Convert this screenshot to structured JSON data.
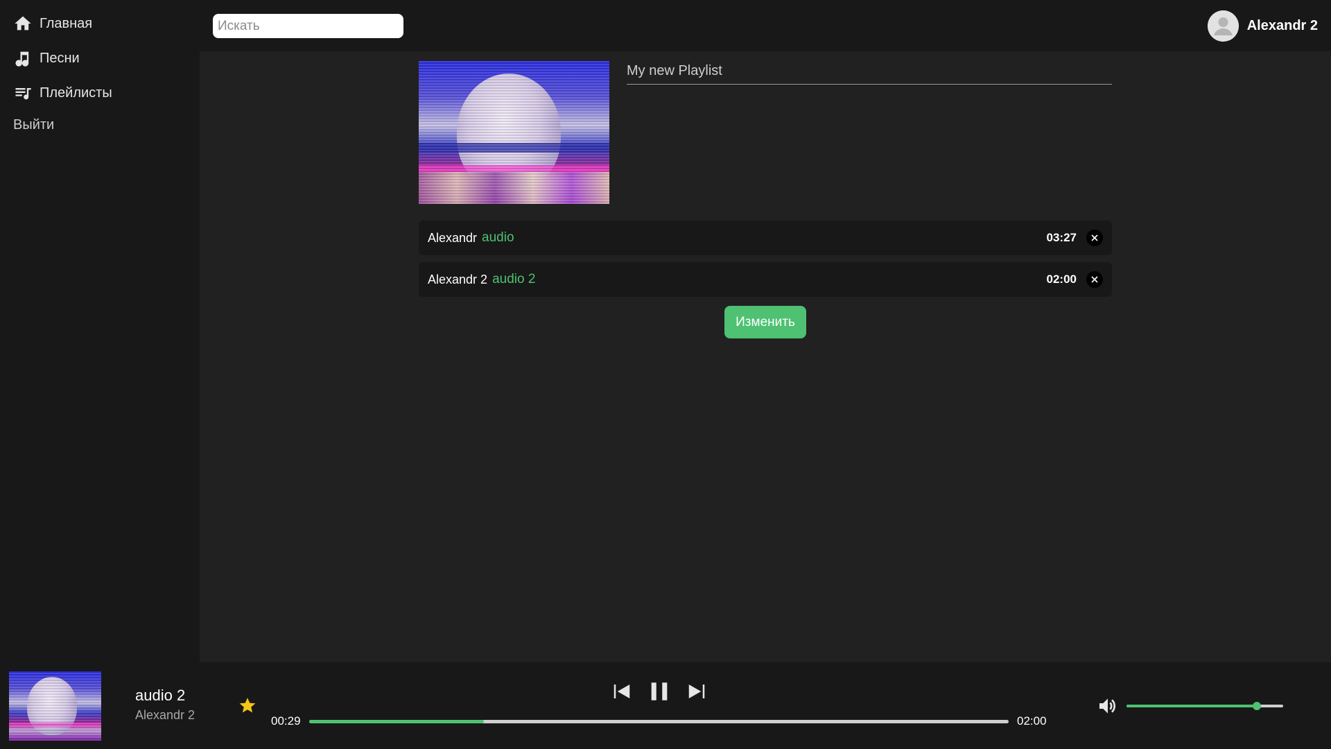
{
  "sidebar": {
    "items": [
      {
        "label": "Главная",
        "icon": "home-icon"
      },
      {
        "label": "Песни",
        "icon": "music-note-icon"
      },
      {
        "label": "Плейлисты",
        "icon": "playlist-icon"
      }
    ],
    "logout_label": "Выйти"
  },
  "header": {
    "search_placeholder": "Искать",
    "user_name": "Alexandr 2",
    "avatar_icon": "user-avatar-icon"
  },
  "playlist": {
    "title": "My new Playlist",
    "tracks": [
      {
        "artist": "Alexandr",
        "name": "audio",
        "duration": "03:27"
      },
      {
        "artist": "Alexandr 2",
        "name": "audio 2",
        "duration": "02:00"
      }
    ],
    "edit_label": "Изменить"
  },
  "player": {
    "title": "audio 2",
    "artist": "Alexandr 2",
    "current_time": "00:29",
    "total_time": "02:00",
    "progress": 0.25,
    "volume": 0.83,
    "favorite": true
  },
  "colors": {
    "accent": "#4ec172",
    "background": "#212121",
    "panel": "#181818",
    "star": "#f5c518"
  }
}
